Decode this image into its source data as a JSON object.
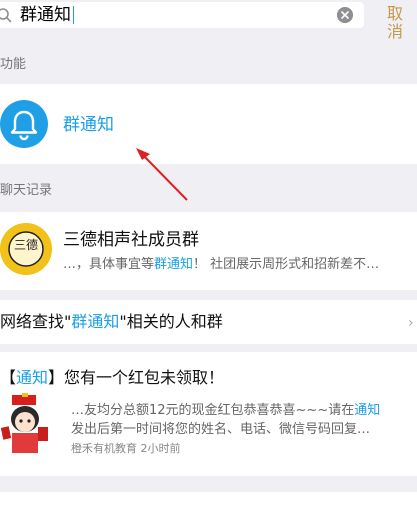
{
  "search": {
    "query": "群通知",
    "cancel_label": "取消"
  },
  "function_section": {
    "label": "功能",
    "item_label": "群通知"
  },
  "chat_section": {
    "label": "聊天记录",
    "group_name": "三德相声社成员群",
    "snippet_before": "…，具体事宜等",
    "snippet_highlight": "群通知",
    "snippet_after": "！ 社团展示周形式和招新差不…",
    "avatar_text": "三德"
  },
  "network_search": {
    "prefix": "网络查找\"",
    "highlight": "群通知",
    "suffix": "\"相关的人和群"
  },
  "message_result": {
    "title_open": "【",
    "title_highlight": "通知",
    "title_close": "】您有一个红包未领取！",
    "line1_before": "…友均分总额12元的现金红包恭喜恭喜~~~请在",
    "line1_highlight": "通知",
    "line2": "发出后第一时间将您的姓名、电话、微信号码回复…",
    "source": "橙禾有机教育",
    "time": "2小时前"
  },
  "colors": {
    "accent_blue": "#1aa0e8",
    "cancel_gold": "#c49a4a",
    "annotation_red": "#e02020"
  }
}
